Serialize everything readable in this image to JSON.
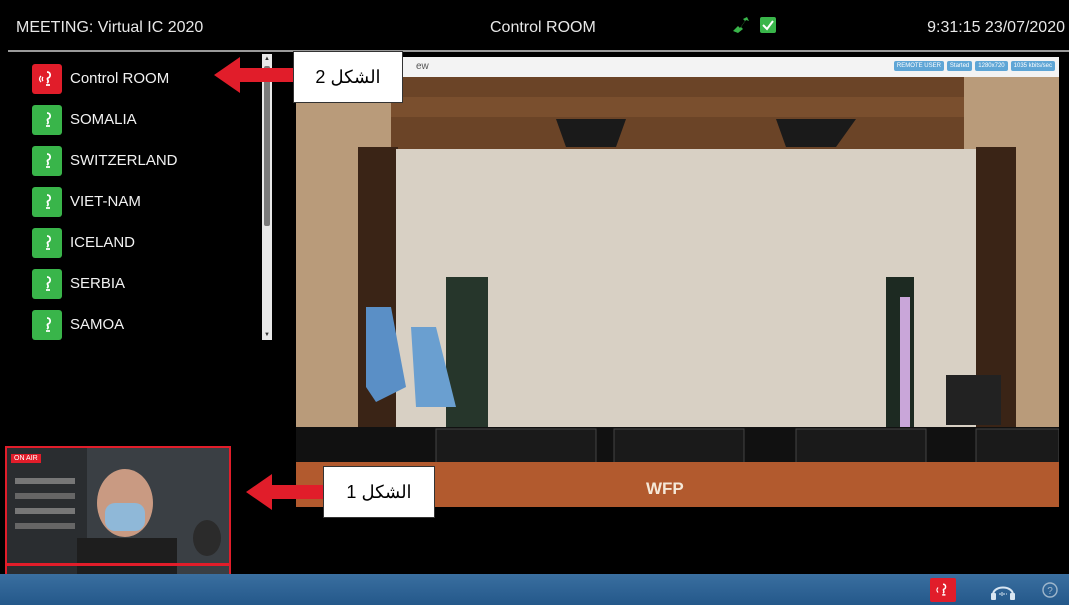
{
  "header": {
    "meeting": "MEETING: Virtual IC 2020",
    "room": "Control ROOM",
    "clock": "9:31:15 23/07/2020"
  },
  "rooms": [
    {
      "label": "Control ROOM",
      "state": "active"
    },
    {
      "label": "SOMALIA",
      "state": "ready"
    },
    {
      "label": "SWITZERLAND",
      "state": "ready"
    },
    {
      "label": "VIET-NAM",
      "state": "ready"
    },
    {
      "label": "ICELAND",
      "state": "ready"
    },
    {
      "label": "SERBIA",
      "state": "ready"
    },
    {
      "label": "SAMOA",
      "state": "ready"
    }
  ],
  "video": {
    "title": "ew",
    "badges": [
      "REMOTE USER",
      "Started",
      "1280x720",
      "1035 kbits/sec"
    ],
    "desk_label": "WFP"
  },
  "pip": {
    "badge": "ON AIR"
  },
  "callouts": {
    "one": "الشكل 1",
    "two": "الشكل 2"
  },
  "colors": {
    "active": "#e11d2a",
    "ready": "#39b54a",
    "bottombar": "#2d6394"
  },
  "icons": [
    "plug-icon",
    "checkbox-icon",
    "speaker-icon",
    "headphones-icon",
    "help-icon"
  ]
}
